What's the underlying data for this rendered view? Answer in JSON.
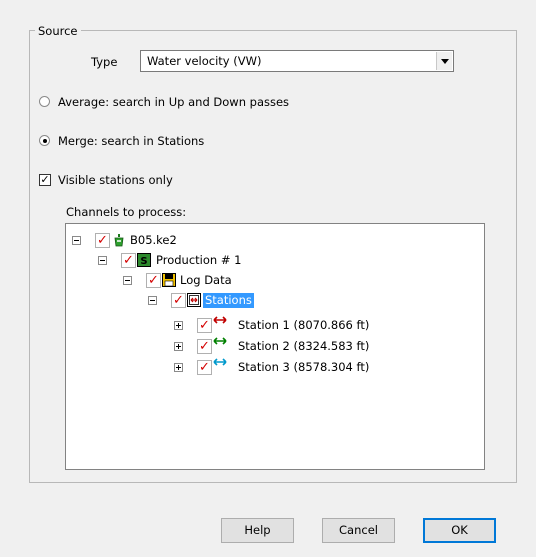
{
  "source_group": {
    "label": "Source"
  },
  "type_field": {
    "label": "Type",
    "value": "Water velocity (VW)"
  },
  "options": {
    "average": {
      "label": "Average: search in Up and Down passes",
      "checked": false
    },
    "merge": {
      "label": "Merge: search in Stations",
      "checked": true
    }
  },
  "visible_stations": {
    "label": "Visible stations only",
    "checked": true
  },
  "channels": {
    "label": "Channels to process:",
    "tree": [
      {
        "label": "B05.ke2",
        "icon": "well-icon",
        "checked": true
      },
      {
        "label": "Production # 1",
        "icon": "s-icon",
        "checked": true
      },
      {
        "label": "Log Data",
        "icon": "folder-icon",
        "checked": true
      },
      {
        "label": "Stations",
        "icon": "stations-icon",
        "checked": true,
        "selected": true
      },
      {
        "label": "Station 1 (8070.866 ft)",
        "icon": "station-arrow-icon",
        "checked": true,
        "arrow_color": "#c00000"
      },
      {
        "label": "Station 2 (8324.583 ft)",
        "icon": "station-arrow-icon",
        "checked": true,
        "arrow_color": "#008000"
      },
      {
        "label": "Station 3 (8578.304 ft)",
        "icon": "station-arrow-icon",
        "checked": true,
        "arrow_color": "#0099cc"
      }
    ]
  },
  "buttons": {
    "help": "Help",
    "cancel": "Cancel",
    "ok": "OK"
  },
  "colors": {
    "selection": "#3399ff",
    "check": "#d40000",
    "default_border": "#0078d7"
  }
}
